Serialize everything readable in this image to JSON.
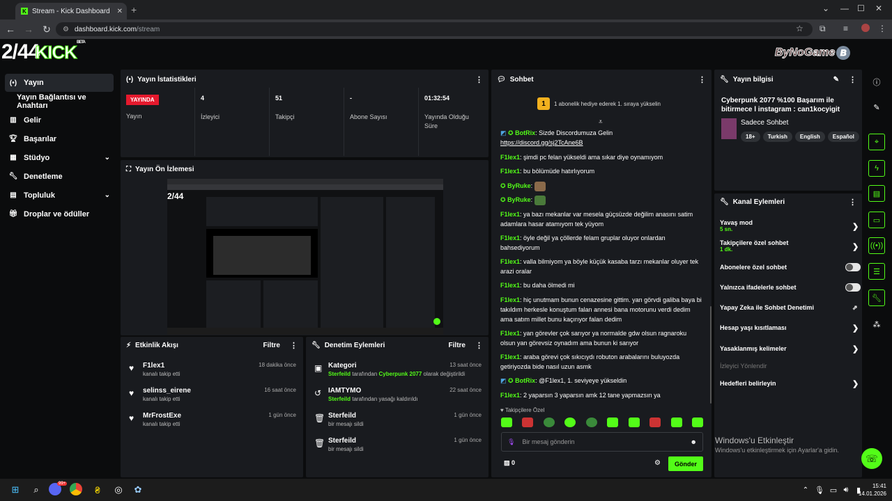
{
  "browser": {
    "tab_title": "Stream - Kick Dashboard",
    "new_tab": "+",
    "url_host": "dashboard.kick.com",
    "url_path": "/stream"
  },
  "header": {
    "logo_text": "2/44",
    "logo_kick": "KICK",
    "logo_beta": "BETA",
    "watermark": "ByNoGame",
    "watermark_badge": "B"
  },
  "sidebar": {
    "items": [
      {
        "label": "Yayın",
        "icon": "broadcast-icon"
      },
      {
        "label": "Yayın Bağlantısı ve Anahtarı",
        "icon": ""
      },
      {
        "label": "Gelir",
        "icon": "chart-icon"
      },
      {
        "label": "Başarılar",
        "icon": "trophy-icon"
      },
      {
        "label": "Stüdyo",
        "icon": "studio-icon"
      },
      {
        "label": "Denetleme",
        "icon": "wrench-icon"
      },
      {
        "label": "Topluluk",
        "icon": "community-icon"
      },
      {
        "label": "Droplar ve ödüller",
        "icon": "gift-icon"
      }
    ]
  },
  "stats": {
    "title": "Yayın İstatistikleri",
    "live_badge": "YAYINDA",
    "live_label": "Yayın",
    "viewers_value": "4",
    "viewers_label": "İzleyici",
    "followers_value": "51",
    "followers_label": "Takipçi",
    "subs_value": "-",
    "subs_label": "Abone Sayısı",
    "uptime_value": "01:32:54",
    "uptime_label": "Yayında Olduğu Süre"
  },
  "preview": {
    "title": "Yayın Ön İzlemesi"
  },
  "activity": {
    "title": "Etkinlik Akışı",
    "filter": "Filtre",
    "items": [
      {
        "name": "F1lex1",
        "desc": "kanalı takip etti",
        "time": "18 dakika önce"
      },
      {
        "name": "selinss_eirene",
        "desc": "kanalı takip etti",
        "time": "16 saat önce"
      },
      {
        "name": "MrFrostExe",
        "desc": "kanalı takip etti",
        "time": "1 gün önce"
      }
    ]
  },
  "moderation": {
    "title": "Denetim Eylemleri",
    "filter": "Filtre",
    "items": [
      {
        "name": "Kategori",
        "actor": "Sterfeild",
        "mid": " tarafından ",
        "target": "Cyberpunk 2077",
        "rest": " olarak değiştirildi",
        "time": "13 saat önce"
      },
      {
        "name": "IAMTYMO",
        "actor": "Sterfeild",
        "mid": " tarafından yasağı kaldırıldı",
        "target": "",
        "rest": "",
        "time": "22 saat önce"
      },
      {
        "name": "Sterfeild",
        "actor": "",
        "mid": "bir mesajı sildi",
        "target": "",
        "rest": "",
        "time": "1 gün önce"
      },
      {
        "name": "Sterfeild",
        "actor": "",
        "mid": "bir mesajı sildi",
        "target": "",
        "rest": "",
        "time": "1 gün önce"
      }
    ]
  },
  "chat": {
    "title": "Sohbet",
    "gift_banner": "1 abonelik hediye ederek 1. sıraya yükselin",
    "gift_rank": "1",
    "messages": [
      {
        "user": "BotRix",
        "text": "Sizde Discordumuza Gelin",
        "link": "https://discord.gg/sj2TcAne6B"
      },
      {
        "user": "F1lex1",
        "text": "şimdi pc felan yükseldi ama sıkar diye oynamıyom"
      },
      {
        "user": "F1lex1",
        "text": "bu bölümüde hatırlıyorum"
      },
      {
        "user": "ByRuke",
        "text": ""
      },
      {
        "user": "ByRuke",
        "text": ""
      },
      {
        "user": "F1lex1",
        "text": "ya bazı mekanlar var mesela güçsüzde değilim anasını satim adamlara hasar atamıyom tek yüyom"
      },
      {
        "user": "F1lex1",
        "text": "öyle değil ya çöllerde felam gruplar oluyor onlardan bahsediyorum"
      },
      {
        "user": "F1lex1",
        "text": "valla bilmiyom ya böyle küçük kasaba tarzı mekanlar oluyer tek arazi oralar"
      },
      {
        "user": "F1lex1",
        "text": "bu daha ölmedi mi"
      },
      {
        "user": "F1lex1",
        "text": "hiç unutmam bunun cenazesine gittim. yan görvdi galiba baya bi takıldım herkesle konuştum falan annesi bana motorunu verdi dedim ama satım millet bunu kaçırıyor falan dedim"
      },
      {
        "user": "F1lex1",
        "text": "yan görevler çok sarıyor ya normalde gdw olsun ragnaroku olsun yan görevsiz oynadım ama bunun ki sarıyor"
      },
      {
        "user": "F1lex1",
        "text": "araba görevi çok sıkıcıydı robuton arabalarını buluyozda getiriyozda bide nasıl uzun asmk"
      },
      {
        "user": "BotRix",
        "text": "@F1lex1, 1. seviyeye yükseldin"
      },
      {
        "user": "F1lex1",
        "text": "2 yaparsın 3 yaparsın amk 12 tane yapmazsın ya"
      }
    ],
    "followers_only_label": "Takipçilere Özel",
    "input_placeholder": "Bir mesaj gönderin",
    "points": "0",
    "send": "Gönder"
  },
  "stream_info": {
    "title": "Yayın bilgisi",
    "stream_title": "Cyberpunk 2077 %100 Başarım ile bitirmece l instagram : can1kocyigit",
    "category": "Sadece Sohbet",
    "tags": [
      "18+",
      "Turkish",
      "English",
      "Español"
    ]
  },
  "channel_actions": {
    "title": "Kanal Eylemleri",
    "slow_mode": "Yavaş mod",
    "slow_mode_value": "5 sn.",
    "followers_chat": "Takipçilere özel sohbet",
    "followers_chat_value": "1 dk.",
    "subs_chat": "Abonelere özel sohbet",
    "emotes_chat": "Yalnızca ifadelerle sohbet",
    "ai_moderation": "Yapay Zeka ile Sohbet Denetimi",
    "age_restriction": "Hesap yaşı kısıtlaması",
    "banned_words": "Yasaklanmış kelimeler",
    "viewer_redirect": "İzleyici Yönlendir",
    "set_goals": "Hedefleri belirleyin"
  },
  "windows": {
    "activate_title": "Windows'u Etkinleştir",
    "activate_sub": "Windows'u etkinleştirmek için Ayarlar'a gidin.",
    "time": "15:41",
    "date": "14.01.2026",
    "discord_badge": "99+"
  },
  "colors": {
    "accent": "#53fc18",
    "live": "#e5192d",
    "panel": "#191b1f",
    "background": "#0b0c0d"
  }
}
